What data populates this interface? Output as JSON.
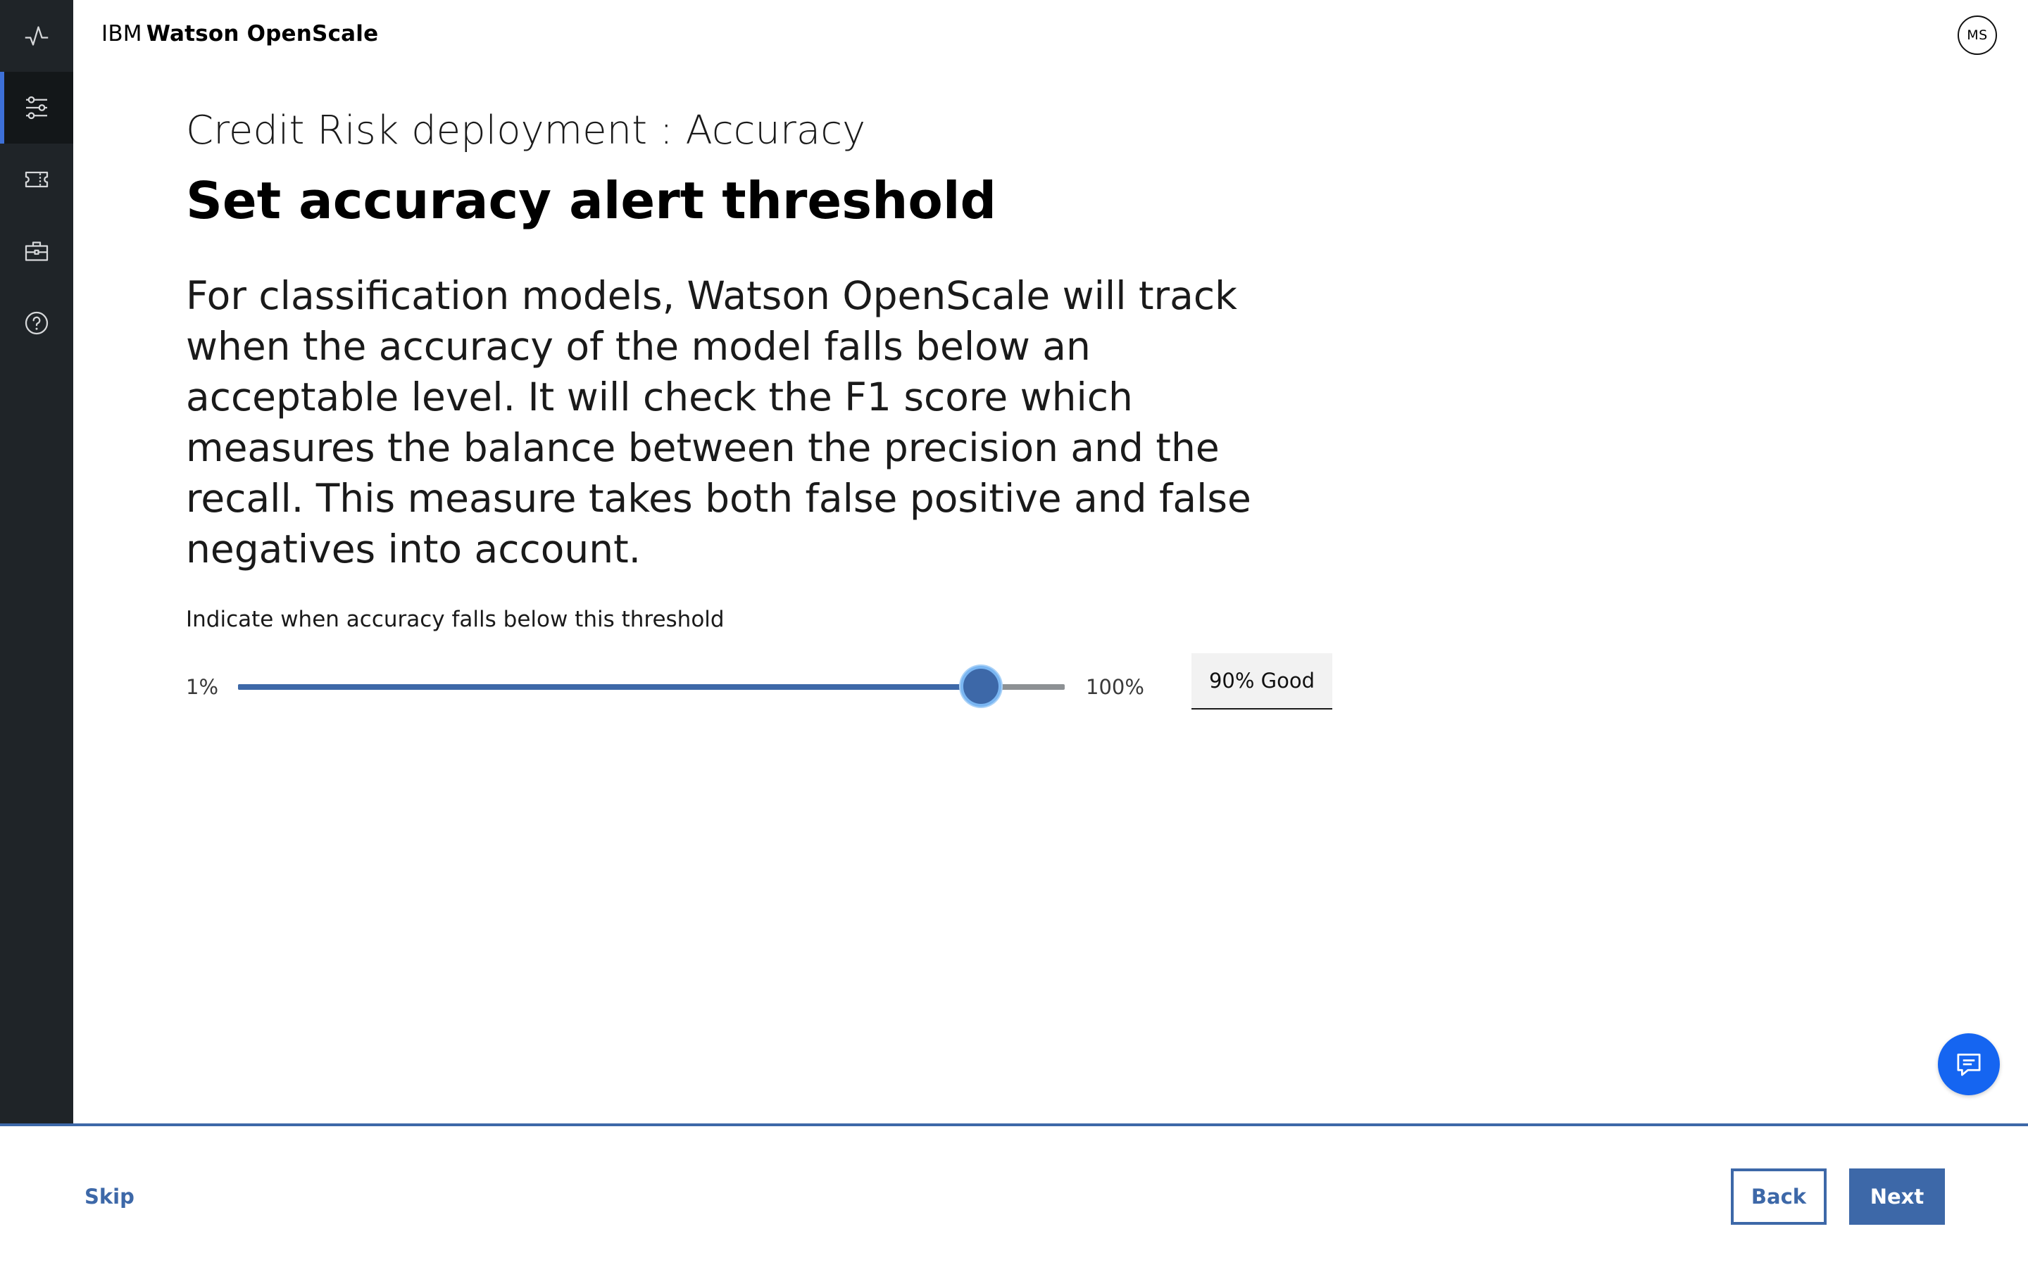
{
  "app": {
    "brand_prefix": "IBM",
    "brand_name": "Watson OpenScale"
  },
  "sidebar": {
    "items": [
      {
        "icon": "activity-icon",
        "active": false
      },
      {
        "icon": "sliders-icon",
        "active": true
      },
      {
        "icon": "ticket-icon",
        "active": false
      },
      {
        "icon": "toolbox-icon",
        "active": false
      },
      {
        "icon": "help-icon",
        "active": false
      }
    ]
  },
  "user": {
    "initials": "MS"
  },
  "page": {
    "subtitle": "Credit Risk deployment : Accuracy",
    "title": "Set accuracy alert threshold",
    "description": "For classification models, Watson OpenScale will track when the accuracy of the model falls below an acceptable level. It will check the F1 score which measures the balance between the precision and the recall. This measure takes both false positive and false negatives into account."
  },
  "slider": {
    "label": "Indicate when accuracy falls below this threshold",
    "min_label": "1%",
    "max_label": "100%",
    "min": 1,
    "max": 100,
    "value": 90,
    "value_display": "90% Good"
  },
  "footer": {
    "skip_label": "Skip",
    "back_label": "Back",
    "next_label": "Next"
  },
  "colors": {
    "sidebar_bg": "#1f2428",
    "accent": "#3d68a8",
    "chat_fab": "#1565f1",
    "active_indicator": "#3d70d8"
  }
}
